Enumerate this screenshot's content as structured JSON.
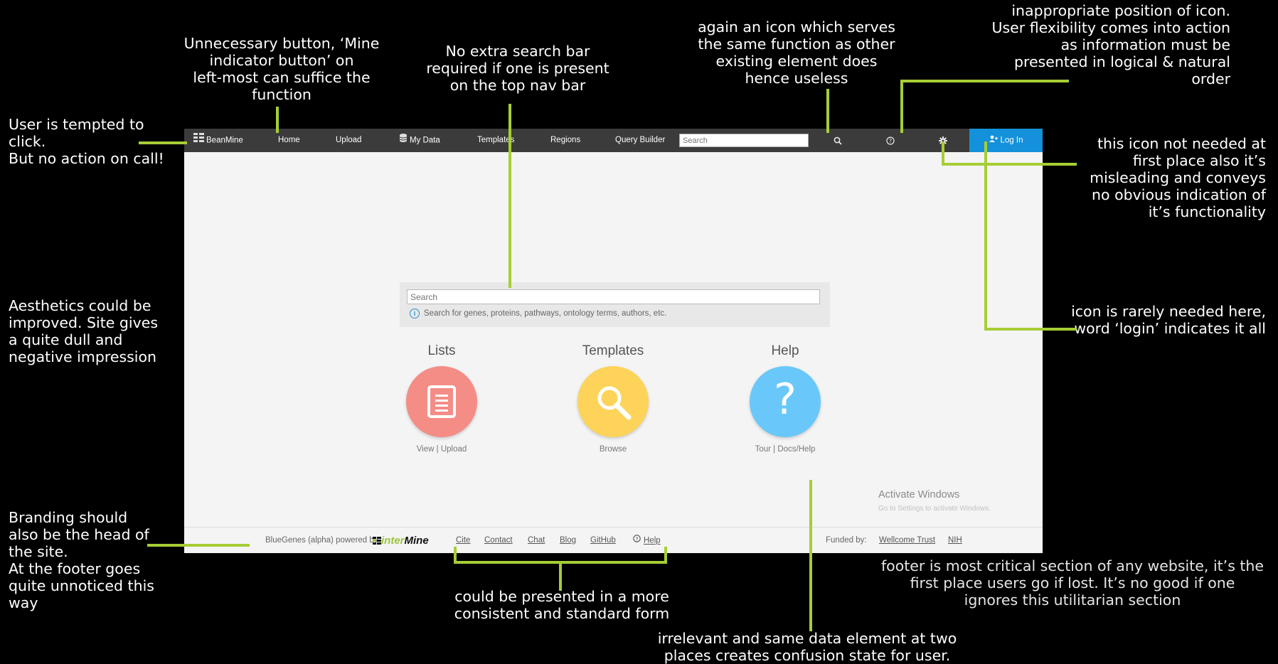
{
  "nav": {
    "brand": "BeanMine",
    "home": "Home",
    "upload": "Upload",
    "my_data": "My Data",
    "templates": "Templates",
    "regions": "Regions",
    "query_builder": "Query Builder",
    "search_placeholder": "Search",
    "login": "Log In"
  },
  "main": {
    "search_placeholder": "Search",
    "search_hint": "Search for genes, proteins, pathways, ontology terms, authors, etc.",
    "cards": [
      {
        "title": "Lists",
        "links": [
          "View",
          "Upload"
        ],
        "color": "#f48d86"
      },
      {
        "title": "Templates",
        "links": [
          "Browse"
        ],
        "color": "#fdd35a"
      },
      {
        "title": "Help",
        "links": [
          "Tour",
          "Docs/Help"
        ],
        "color": "#69c8f9"
      }
    ]
  },
  "footer": {
    "powered": "BlueGenes (alpha) powered by",
    "logo_prefix": "inter",
    "logo_suffix": "Mine",
    "links": [
      "Cite",
      "Contact",
      "Chat",
      "Blog",
      "GitHub",
      "Help"
    ],
    "funded_label": "Funded by:",
    "funders": [
      "Wellcome Trust",
      "NIH"
    ]
  },
  "watermark": {
    "line1": "Activate Windows",
    "line2": "Go to Settings to activate Windows."
  },
  "annotations": {
    "user_tempted": "User is tempted to\nclick.\nBut no action on call!",
    "unnecessary": "Unnecessary button, ‘Mine\nindicator button’ on\nleft-most can suffice the\nfunction",
    "no_extra_search": "No extra search bar\nrequired if one is present\non the top nav bar",
    "again_icon": "again an icon which serves\nthe same function as other\nexisting element does\nhence useless",
    "inappropriate": "inappropriate position of icon.\nUser flexibility comes into action\nas information must be\npresented in logical & natural\norder",
    "icon_not_needed": "this icon not needed at\nfirst place also it’s\nmisleading and conveys\nno obvious indication of\nit’s functionality",
    "aesthetics": "Aesthetics could be\nimproved. Site gives\na quite dull and\nnegative impression",
    "icon_rarely": "icon is rarely needed here,\nword ‘login’ indicates it all",
    "branding": "Branding should\nalso be the head of\nthe site.\nAt the footer goes\nquite unnoticed this\nway",
    "consistent": "could be presented in a more\nconsistent and standard form",
    "footer_critical": "footer is most critical section of any website, it’s the\nfirst place users go if lost. It’s no good if one\nignores this utilitarian section",
    "irrelevant": "irrelevant and same data element at two\nplaces creates confusion state for user."
  }
}
